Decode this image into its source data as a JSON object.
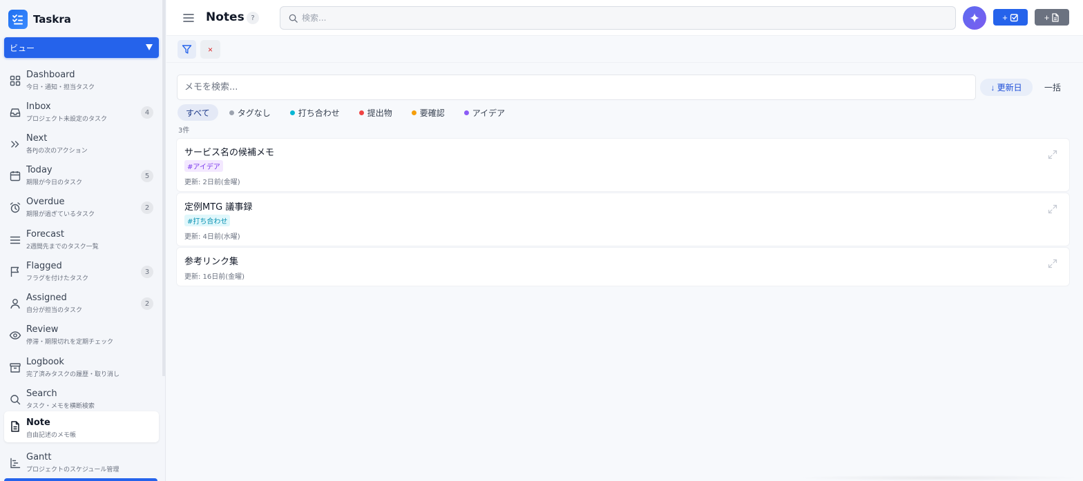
{
  "app": {
    "name": "Taskra"
  },
  "sidebar": {
    "view_select": {
      "label": "ビュー"
    },
    "items": [
      {
        "id": "dashboard",
        "title": "Dashboard",
        "subtitle": "今日・通知・担当タスク",
        "badge": ""
      },
      {
        "id": "inbox",
        "title": "Inbox",
        "subtitle": "プロジェクト未設定のタスク",
        "badge": "4"
      },
      {
        "id": "next",
        "title": "Next",
        "subtitle": "各PJの次のアクション",
        "badge": ""
      },
      {
        "id": "today",
        "title": "Today",
        "subtitle": "期限が今日のタスク",
        "badge": "5"
      },
      {
        "id": "overdue",
        "title": "Overdue",
        "subtitle": "期限が過ぎているタスク",
        "badge": "2"
      },
      {
        "id": "forecast",
        "title": "Forecast",
        "subtitle": "2週間先までのタスク一覧",
        "badge": ""
      },
      {
        "id": "flagged",
        "title": "Flagged",
        "subtitle": "フラグを付けたタスク",
        "badge": "3"
      },
      {
        "id": "assigned",
        "title": "Assigned",
        "subtitle": "自分が担当のタスク",
        "badge": "2"
      },
      {
        "id": "review",
        "title": "Review",
        "subtitle": "停滞・期限切れを定期チェック",
        "badge": ""
      },
      {
        "id": "logbook",
        "title": "Logbook",
        "subtitle": "完了済みタスクの履歴・取り消し",
        "badge": ""
      },
      {
        "id": "search",
        "title": "Search",
        "subtitle": "タスク・メモを横断検索",
        "badge": ""
      },
      {
        "id": "note",
        "title": "Note",
        "subtitle": "自由記述のメモ帳",
        "badge": ""
      },
      {
        "id": "gantt",
        "title": "Gantt",
        "subtitle": "プロジェクトのスケジュール管理",
        "badge": ""
      }
    ],
    "active": "note"
  },
  "header": {
    "title": "Notes",
    "help_label": "?",
    "search_placeholder": "検索...",
    "add_task_label": "+",
    "add_note_label": "+"
  },
  "filters": {
    "clear_label": "×"
  },
  "notes_view": {
    "search_placeholder": "メモを検索...",
    "sort_label": "↓ 更新日",
    "bulk_label": "一括",
    "count_label": "3件",
    "tags": [
      {
        "label": "すべて",
        "color": "",
        "active": true
      },
      {
        "label": "タグなし",
        "color": "#9ca3af",
        "active": false
      },
      {
        "label": "打ち合わせ",
        "color": "#06b6d4",
        "active": false
      },
      {
        "label": "提出物",
        "color": "#ef4444",
        "active": false
      },
      {
        "label": "要確認",
        "color": "#f59e0b",
        "active": false
      },
      {
        "label": "アイデア",
        "color": "#8b5cf6",
        "active": false
      }
    ],
    "notes": [
      {
        "title": "サービス名の候補メモ",
        "tag": "#アイデア",
        "tag_color": "#7c3aed",
        "tag_bg": "#f3e8ff",
        "updated": "更新: 2日前(金曜)"
      },
      {
        "title": "定例MTG 議事録",
        "tag": "#打ち合わせ",
        "tag_color": "#0891b2",
        "tag_bg": "#e0f7fb",
        "updated": "更新: 4日前(水曜)"
      },
      {
        "title": "参考リンク集",
        "tag": "",
        "tag_color": "",
        "tag_bg": "",
        "updated": "更新: 16日前(金曜)"
      }
    ]
  },
  "colors": {
    "accent": "#2563eb",
    "ai": "#6366f1",
    "secondary": "#6b7280"
  }
}
